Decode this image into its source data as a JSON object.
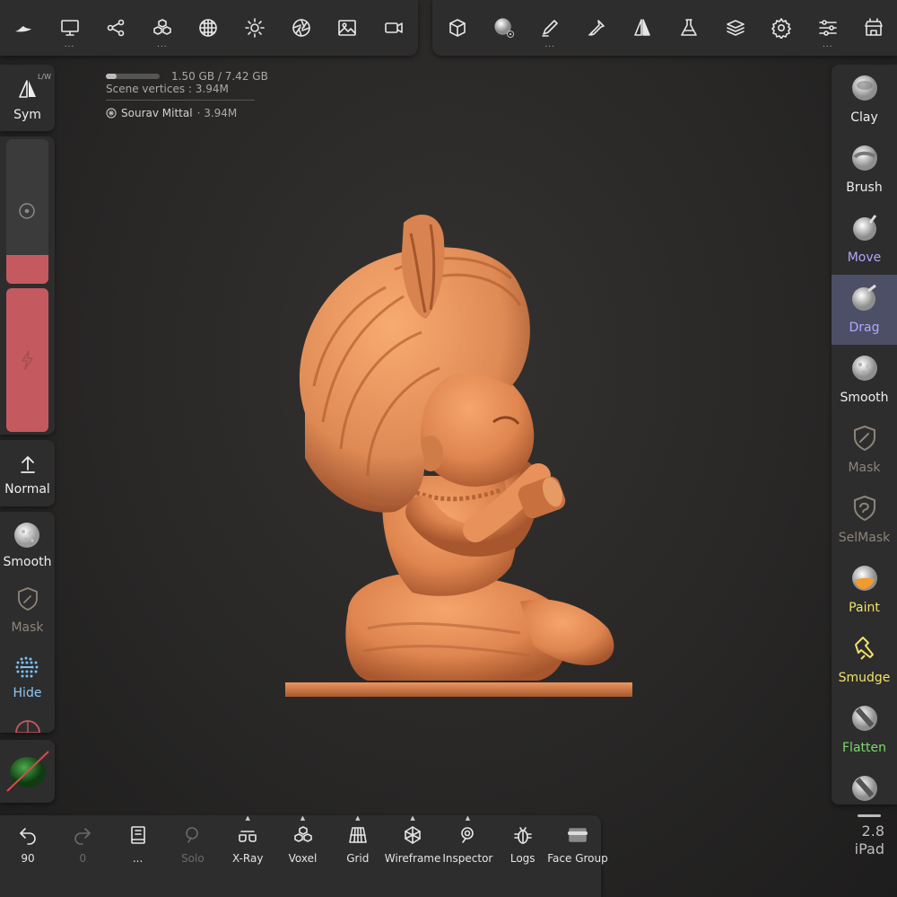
{
  "top_toolbar_left": [
    {
      "name": "app-logo",
      "icon": "nomad-logo",
      "dots": ""
    },
    {
      "name": "scene-button",
      "icon": "monitor-icon",
      "dots": "..."
    },
    {
      "name": "hierarchy-button",
      "icon": "nodes-icon",
      "dots": ""
    },
    {
      "name": "primitives-button",
      "icon": "cubes-icon",
      "dots": "..."
    },
    {
      "name": "background-button",
      "icon": "sphere-grid-icon",
      "dots": ""
    },
    {
      "name": "lighting-button",
      "icon": "sun-icon",
      "dots": ""
    },
    {
      "name": "camera-aperture-button",
      "icon": "aperture-icon",
      "dots": ""
    },
    {
      "name": "background-image-button",
      "icon": "image-icon",
      "dots": ""
    },
    {
      "name": "record-button",
      "icon": "camera-icon",
      "dots": ""
    }
  ],
  "top_toolbar_right": [
    {
      "name": "material-cube-button",
      "icon": "cube-icon",
      "dots": ""
    },
    {
      "name": "matcap-button",
      "icon": "matcap-sphere-icon",
      "dots": ""
    },
    {
      "name": "painting-button",
      "icon": "pen-icon",
      "dots": "..."
    },
    {
      "name": "paint-tools-button",
      "icon": "dropper-icon",
      "dots": ""
    },
    {
      "name": "symmetry-button",
      "icon": "symmetry-icon",
      "dots": ""
    },
    {
      "name": "filters-button",
      "icon": "flask-icon",
      "dots": ""
    },
    {
      "name": "layers-button",
      "icon": "layers-icon",
      "dots": ""
    },
    {
      "name": "settings-button",
      "icon": "gear-icon",
      "dots": ""
    },
    {
      "name": "interface-button",
      "icon": "sliders-icon",
      "dots": "..."
    },
    {
      "name": "store-button",
      "icon": "shop-icon",
      "dots": ""
    }
  ],
  "info": {
    "memory": "1.50 GB / 7.42 GB",
    "memory_ratio": 0.2,
    "vertices": "Scene vertices : 3.94M",
    "object_name": "Sourav Mittal",
    "object_count": "· 3.94M"
  },
  "left_panel": {
    "sym_label": "Sym",
    "sym_lw": "L/W",
    "radius_level": 0.2,
    "intensity_level": 1.0,
    "normal_label": "Normal",
    "quick_tools": [
      "Smooth",
      "Mask",
      "Hide"
    ]
  },
  "right_tools": [
    {
      "label": "Clay",
      "color": "#eeeeee"
    },
    {
      "label": "Brush",
      "color": "#eeeeee"
    },
    {
      "label": "Move",
      "color": "#b2a6ff"
    },
    {
      "label": "Drag",
      "color": "#b2a6ff"
    },
    {
      "label": "Smooth",
      "color": "#eeeeee"
    },
    {
      "label": "Mask",
      "color": "#8c8477"
    },
    {
      "label": "SelMask",
      "color": "#8c8477"
    },
    {
      "label": "Paint",
      "color": "#f0e26a"
    },
    {
      "label": "Smudge",
      "color": "#f0e26a"
    },
    {
      "label": "Flatten",
      "color": "#7dd86e"
    }
  ],
  "bottom_toolbar": [
    {
      "name": "undo-button",
      "label": "90",
      "icon": "undo-icon",
      "dim": false,
      "caret": false
    },
    {
      "name": "redo-button",
      "label": "0",
      "icon": "redo-icon",
      "dim": true,
      "caret": false
    },
    {
      "name": "topology-button",
      "label": "...",
      "icon": "book-icon",
      "dim": false,
      "caret": false
    },
    {
      "name": "solo-button",
      "label": "Solo",
      "icon": "search-icon",
      "dim": true,
      "caret": false
    },
    {
      "name": "xray-button",
      "label": "X-Ray",
      "icon": "glasses-icon",
      "dim": false,
      "caret": true
    },
    {
      "name": "voxel-button",
      "label": "Voxel",
      "icon": "cubes-icon",
      "dim": false,
      "caret": true
    },
    {
      "name": "grid-button",
      "label": "Grid",
      "icon": "grid-icon",
      "dim": false,
      "caret": true
    },
    {
      "name": "wireframe-button",
      "label": "Wireframe",
      "icon": "wireframe-icon",
      "dim": false,
      "caret": true
    },
    {
      "name": "inspector-button",
      "label": "Inspector",
      "icon": "inspector-icon",
      "dim": false,
      "caret": true
    },
    {
      "name": "logs-button",
      "label": "Logs",
      "icon": "bug-icon",
      "dim": false,
      "caret": false
    },
    {
      "name": "face-group-button",
      "label": "Face Group",
      "icon": "face-group-icon",
      "dim": false,
      "caret": false
    }
  ],
  "version": {
    "number": "2.8",
    "device": "iPad"
  },
  "colors": {
    "accent": "#c45a5f",
    "active_tool": "#4d4f66",
    "model": "#e8915a"
  }
}
